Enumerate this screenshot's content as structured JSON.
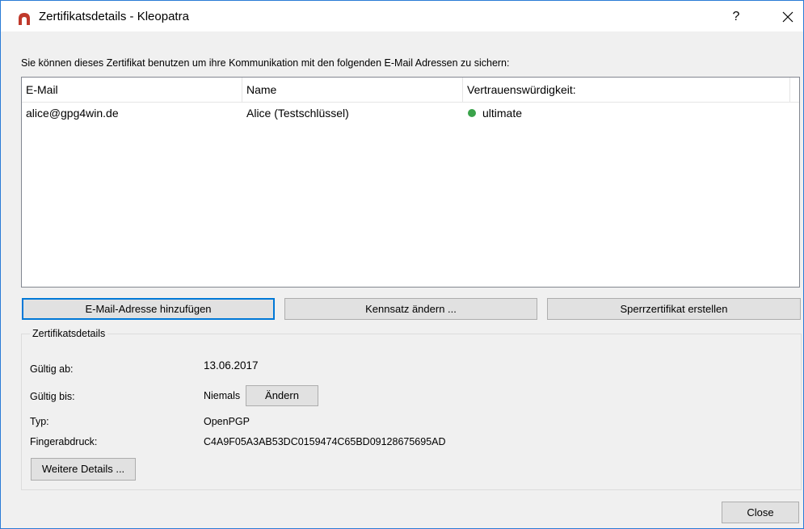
{
  "window": {
    "title": "Zertifikatsdetails - Kleopatra",
    "help_label": "?",
    "close_glyph": "✕"
  },
  "intro_text": "Sie können dieses Zertifikat benutzen um ihre Kommunikation mit den folgenden E-Mail Adressen zu sichern:",
  "table": {
    "columns": [
      "E-Mail",
      "Name",
      "Vertrauenswürdigkeit:"
    ],
    "rows": [
      {
        "email": "alice@gpg4win.de",
        "name": "Alice (Testschlüssel)",
        "trust": "ultimate"
      }
    ]
  },
  "buttons": {
    "add_email": "E-Mail-Adresse hinzufügen",
    "change_passphrase": "Kennsatz ändern ...",
    "create_revocation": "Sperrzertifikat erstellen",
    "change_expiry": "Ändern",
    "more_details": "Weitere Details ...",
    "close": "Close"
  },
  "details": {
    "group_title": "Zertifikatsdetails",
    "valid_from_label": "Gültig ab:",
    "valid_from_value": "13.06.2017",
    "valid_until_label": "Gültig bis:",
    "valid_until_value": "Niemals",
    "type_label": "Typ:",
    "type_value": "OpenPGP",
    "fingerprint_label": "Fingerabdruck:",
    "fingerprint_value": "C4A9F05A3AB53DC0159474C65BD09128675695AD"
  },
  "colors": {
    "focus": "#0078d7",
    "trust_ok": "#3aa34a",
    "app_icon": "#c0392b"
  },
  "icons": {
    "app": "kleopatra-icon",
    "trust": "check-circle-icon"
  }
}
